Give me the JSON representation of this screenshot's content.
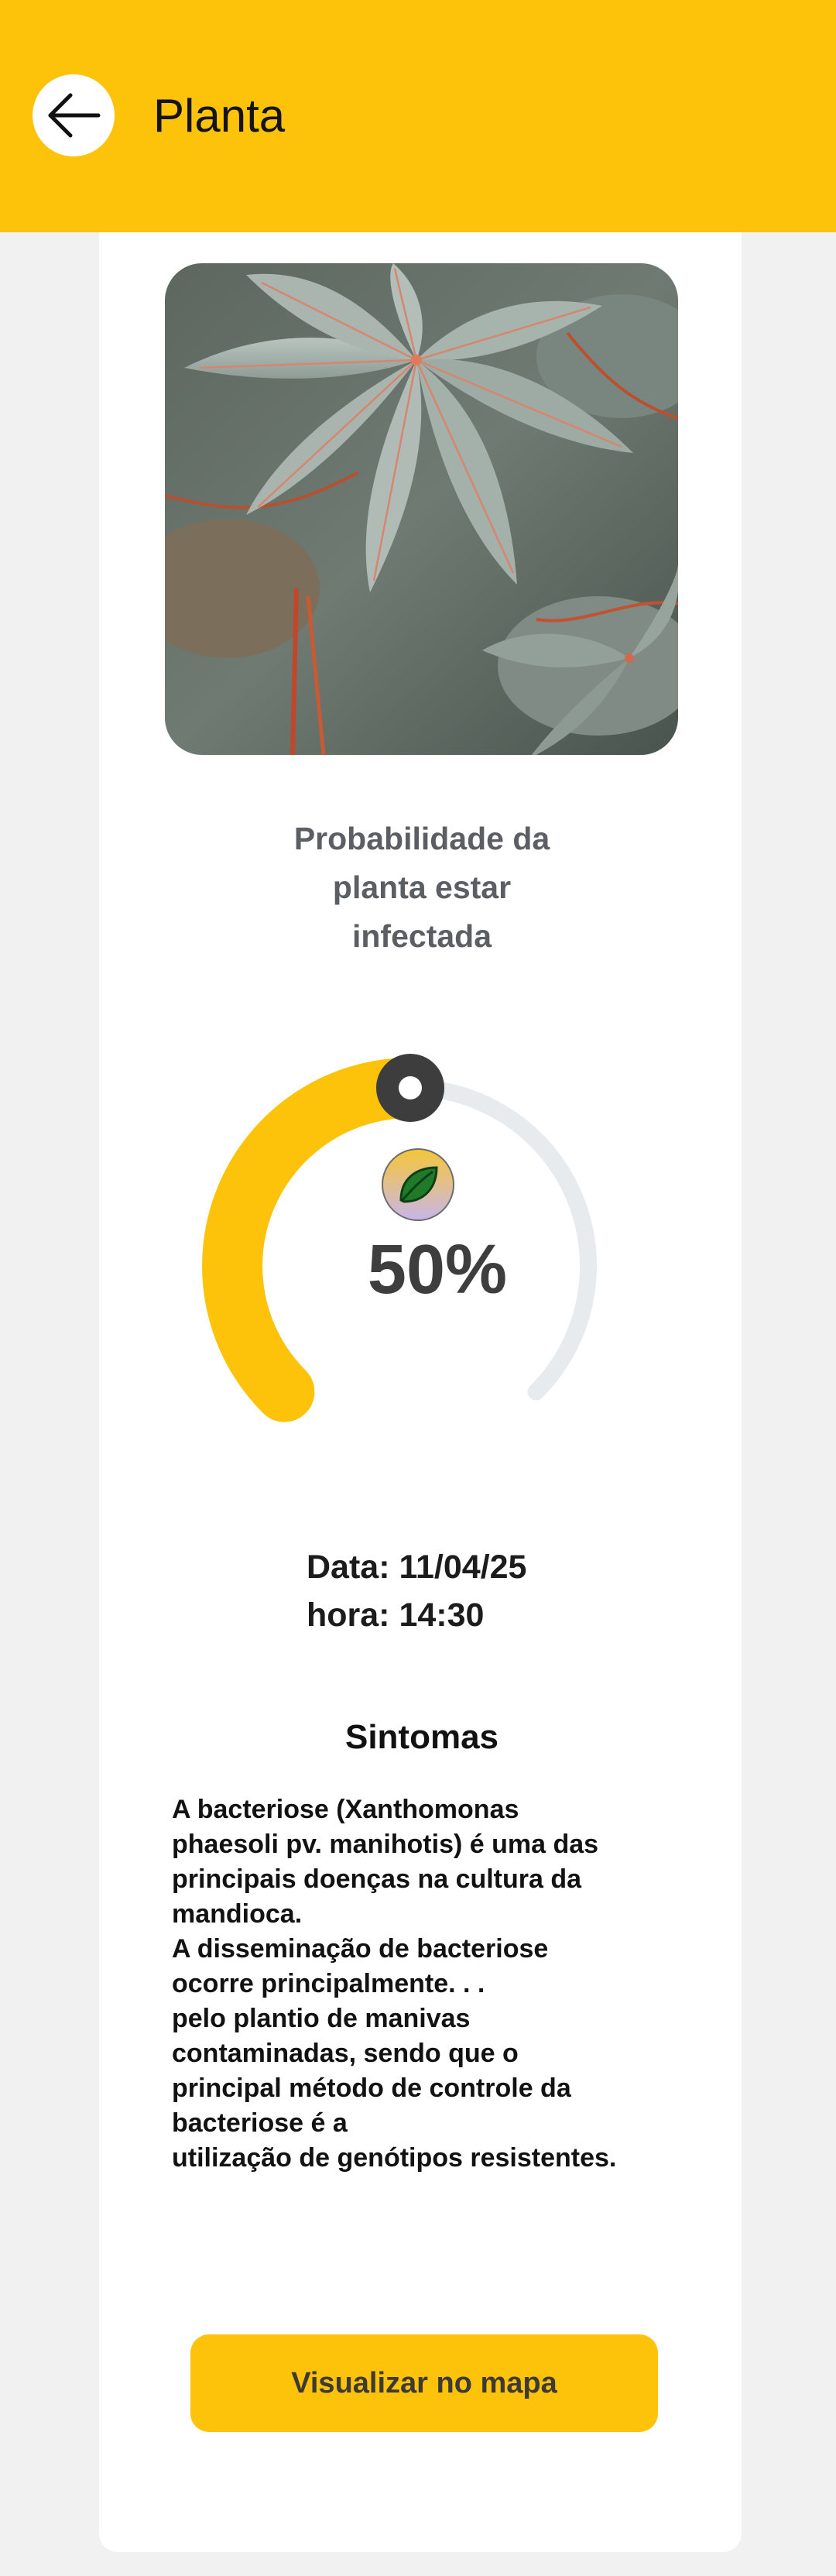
{
  "header": {
    "title": "Planta",
    "back_icon": "arrow-left-icon",
    "background_color": "#fdc20a"
  },
  "plant_photo": {
    "description_icon": "plant-photo"
  },
  "probability": {
    "title_lines": [
      "Probabilidade da",
      "planta estar",
      "infectada"
    ],
    "value_text": "50%",
    "value_fraction": 0.5,
    "badge_icon": "leaf-icon",
    "fill_color": "#fdc20a",
    "track_color": "#e8ebee"
  },
  "info": {
    "date": "Data: 11/04/25",
    "time": "hora: 14:30"
  },
  "symptoms": {
    "title": "Sintomas",
    "lines": [
      "A bacteriose (Xanthomonas",
      "phaesoli pv. manihotis) é uma das",
      "principais doenças na cultura da",
      "mandioca.",
      "A disseminação de bacteriose",
      "ocorre principalmente. . .",
      "pelo plantio de manivas",
      "contaminadas, sendo que o",
      "principal método de controle da",
      "bacteriose é a",
      "utilização de genótipos resistentes."
    ]
  },
  "map_button": {
    "label": "Visualizar no mapa"
  }
}
